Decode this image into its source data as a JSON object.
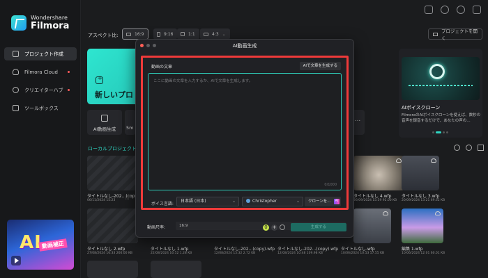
{
  "app": {
    "brand": "Wondershare",
    "product": "Filmora"
  },
  "sidebar": {
    "items": [
      {
        "label": "プロジェクト作成",
        "icon": "film-icon",
        "active": true
      },
      {
        "label": "Filmora Cloud",
        "icon": "cloud-icon",
        "badge": true
      },
      {
        "label": "クリエイターハブ",
        "icon": "bulb-icon",
        "badge": true
      },
      {
        "label": "ツールボックス",
        "icon": "toolbox-icon"
      }
    ],
    "promo": {
      "ai_text": "AI",
      "tag": "動画補正"
    }
  },
  "topbar": {
    "aspect_label": "アスペクト比:",
    "aspect_options": [
      "16:9",
      "9:16",
      "1:1",
      "4:3"
    ],
    "aspect_selected": "16:9",
    "open_project": "プロジェクトを開く"
  },
  "main": {
    "new_project": "新しいプロ",
    "tools": [
      {
        "label": "AI動画生成",
        "icon": "ai-video-icon"
      },
      {
        "label": "5m",
        "icon": "tool-icon"
      }
    ],
    "more": "...",
    "local_projects_title": "ローカルプロジェクト",
    "promo_card": {
      "title": "AIボイスクローン",
      "desc": "FilmoraのAIボイスクローンを使えば、数秒の音声を録音するだけで、あなたの声の…"
    },
    "projects_row1": [
      {
        "name": "タイトルなし-202...(copy).wfp",
        "meta": "06/11/2024 15:23"
      },
      {
        "name": "タイトルなし 4.wfp",
        "meta": "26/09/2024 15:59   92.00 KB"
      },
      {
        "name": "タイトルなし 3.wfp",
        "meta": "20/09/2024 13:21   69.62 KB"
      }
    ],
    "projects_row2": [
      {
        "name": "タイトルなし 2.wfp",
        "meta": "27/08/2024 16:33   260.00 KB"
      },
      {
        "name": "タイトルなし 1.wfp",
        "meta": "22/08/2024 16:52   1.28 KB"
      },
      {
        "name": "タイトルなし-202...(copy).wfp",
        "meta": "12/08/2024 15:32   2.72 KB"
      },
      {
        "name": "タイトルなし-202...(copy).wfp",
        "meta": "12/08/2024 10:48   109.98 KB"
      },
      {
        "name": "タイトルなし.wfp",
        "meta": "10/06/2024 10:53   57.55 KB"
      },
      {
        "name": "編集 1.wfp",
        "meta": "10/06/2024 12:01   60.01 KB"
      }
    ]
  },
  "dialog": {
    "title": "AI動画生成",
    "text_label": "動画の文章",
    "generate_text_btn": "AIで文章を生成する",
    "textarea_placeholder": "ここに動画の文章を入力するか、AIで文章を生成します。",
    "counter": "0/1000",
    "voice_lang_label": "ボイス言語:",
    "voice_lang_value": "日本語 (日本)",
    "voice_value": "Christopher",
    "clone_btn": "クローンを...",
    "clone_badge": "AI",
    "duration_label": "動画尺率:",
    "duration_value": "16:9",
    "credits_count": "0",
    "generate_btn": "生成する"
  },
  "colors": {
    "accent": "#2fd6c3",
    "highlight": "#ef3a3a",
    "background": "#1b1c1e"
  }
}
